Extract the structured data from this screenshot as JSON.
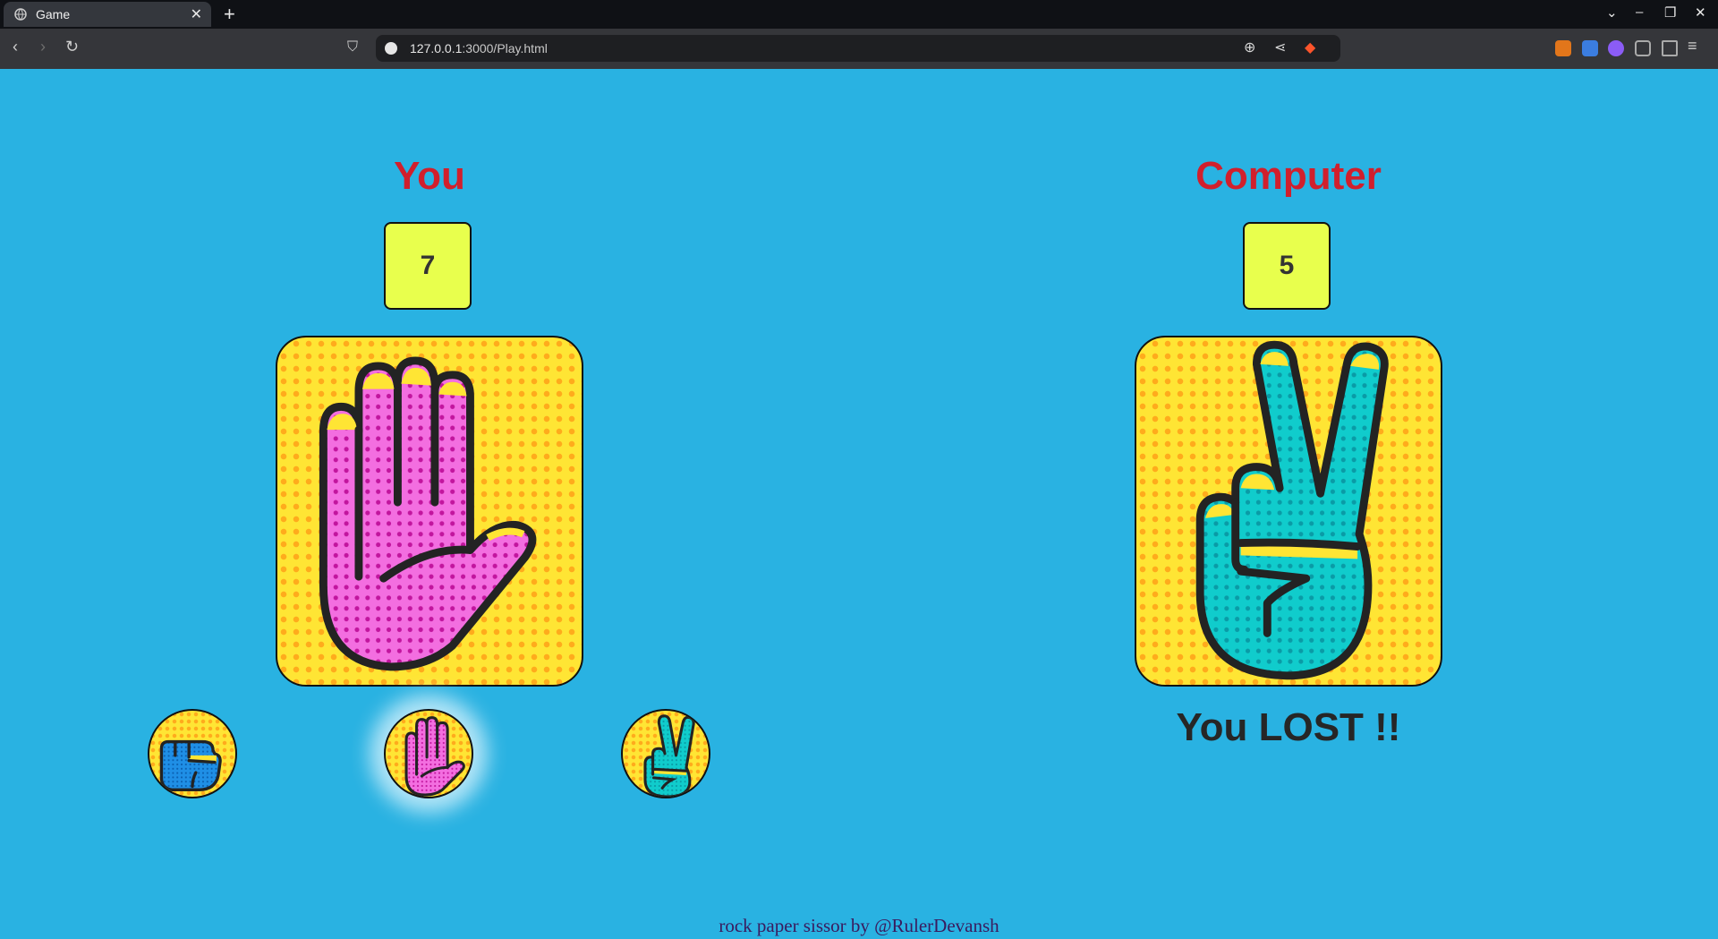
{
  "browser": {
    "tab_title": "Game",
    "tab_close": "✕",
    "new_tab": "+",
    "url_host": "127.0.0.1",
    "url_rest": ":3000/Play.html"
  },
  "game": {
    "player_label": "You",
    "computer_label": "Computer",
    "player_score": "7",
    "computer_score": "5",
    "player_choice": "paper",
    "computer_choice": "scissors",
    "choices": [
      "rock",
      "paper",
      "scissors"
    ],
    "result": "You LOST !!"
  },
  "footer": "rock paper sissor by @RulerDevansh",
  "colors": {
    "page_bg": "#29b2e2",
    "heading": "#d11f2c",
    "score_box": "#e8ff4d",
    "card_yellow": "#ffe534",
    "paper_pink": "#f36ee0",
    "scissors_teal": "#10cccc",
    "rock_blue": "#1f8fe6"
  }
}
